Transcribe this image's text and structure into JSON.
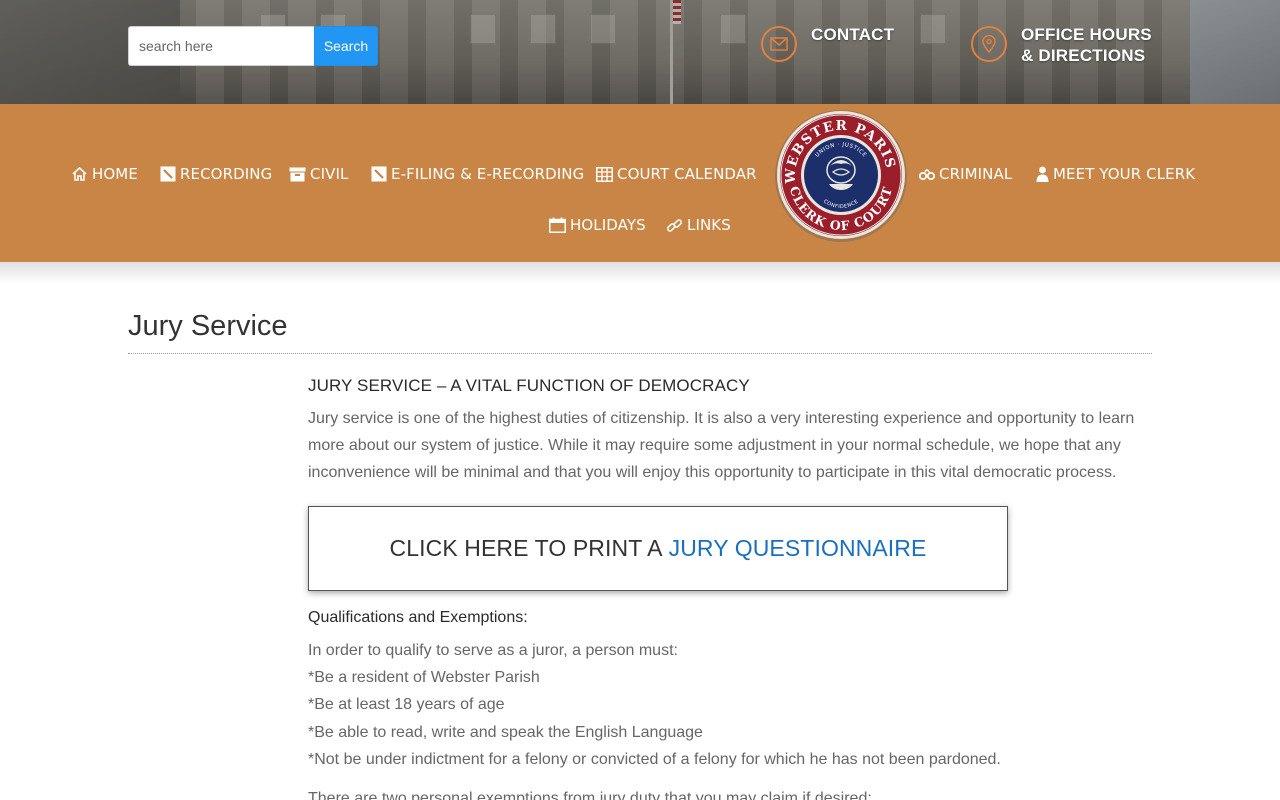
{
  "header": {
    "search": {
      "placeholder": "search here",
      "value": "",
      "button_label": "Search"
    },
    "contact_label": "CONTACT",
    "hours_label": "OFFICE HOURS\n& DIRECTIONS"
  },
  "nav": {
    "items": [
      {
        "label": "HOME",
        "icon": "home-icon"
      },
      {
        "label": "RECORDING",
        "icon": "edit-icon"
      },
      {
        "label": "CIVIL",
        "icon": "archive-icon"
      },
      {
        "label": "E-FILING & E-RECORDING",
        "icon": "edit-icon"
      },
      {
        "label": "COURT CALENDAR",
        "icon": "calendar-grid-icon"
      },
      {
        "label": "CRIMINAL",
        "icon": "handcuffs-icon"
      },
      {
        "label": "MEET YOUR CLERK",
        "icon": "user-icon"
      },
      {
        "label": "HOLIDAYS",
        "icon": "calendar-icon"
      },
      {
        "label": "LINKS",
        "icon": "link-icon"
      }
    ],
    "seal": {
      "top_text": "WEBSTER PARISH",
      "bottom_text": "CLERK OF COURT",
      "inner_top": "UNION · JUSTICE",
      "inner_bottom": "CONFIDENCE"
    }
  },
  "content": {
    "title": "Jury Service",
    "section_heading": "JURY SERVICE – A VITAL FUNCTION OF DEMOCRACY",
    "intro_lines": [
      "Jury service is one of the highest duties of citizenship.  It is also a very interesting experience and opportunity to learn",
      "more about our system of justice.  While it may require some adjustment in your normal schedule, we hope that any",
      "inconvenience will be minimal and that you will enjoy this opportunity to participate in this vital democratic process."
    ],
    "cta": {
      "prefix": "CLICK HERE TO PRINT A",
      "link": "JURY QUESTIONNAIRE"
    },
    "qualifications_heading": "Qualifications and Exemptions:",
    "qualifications": [
      "In order to qualify to serve as a juror, a person must:",
      "*Be a resident of Webster Parish",
      "*Be at least 18 years of age",
      "*Be able to read, write and speak the English Language",
      "*Not be under indictment for a felony or convicted of a felony for which he has not been pardoned."
    ],
    "trailing_text": "There are two personal exemptions from jury duty that you may claim if desired:"
  },
  "colors": {
    "nav_bg": "#c98545",
    "search_button": "#2196f3",
    "link": "#1a6fbf",
    "icon_ring": "#e0813e"
  }
}
